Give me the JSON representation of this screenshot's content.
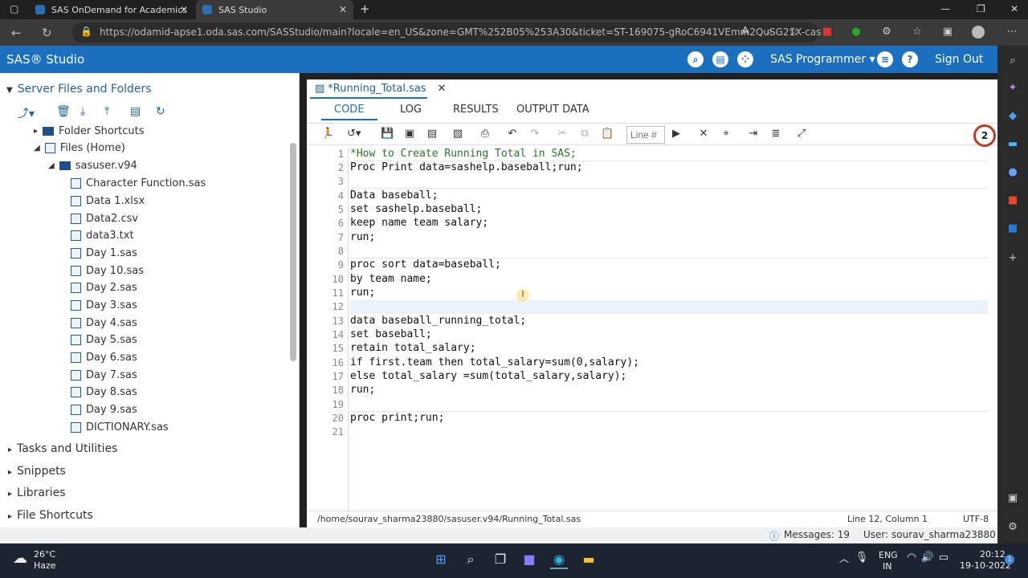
{
  "browser": {
    "tabs": [
      {
        "title": "SAS OnDemand for Academics"
      },
      {
        "title": "SAS Studio"
      }
    ],
    "url": "https://odamid-apse1.oda.sas.com/SASStudio/main?locale=en_US&zone=GMT%252B05%253A30&ticket=ST-169075-gRoC6941VEmm2QuSG21X-cas"
  },
  "app": {
    "brand": "SAS® Studio",
    "role": "SAS Programmer",
    "signout": "Sign Out"
  },
  "sidebar": {
    "header": "Server Files and Folders",
    "folder_shortcuts": "Folder Shortcuts",
    "files_home": "Files (Home)",
    "sasuser": "sasuser.v94",
    "files": [
      "Character Function.sas",
      "Data 1.xlsx",
      "Data2.csv",
      "data3.txt",
      "Day 1.sas",
      "Day 10.sas",
      "Day 2.sas",
      "Day 3.sas",
      "Day 4.sas",
      "Day 5.sas",
      "Day 6.sas",
      "Day 7.sas",
      "Day 8.sas",
      "Day 9.sas",
      "DICTIONARY.sas"
    ],
    "sections": [
      "Tasks and Utilities",
      "Snippets",
      "Libraries",
      "File Shortcuts"
    ]
  },
  "editor": {
    "file_tab": "*Running_Total.sas",
    "subtabs": [
      "CODE",
      "LOG",
      "RESULTS",
      "OUTPUT DATA"
    ],
    "line_placeholder": "Line #",
    "lines": [
      "*How to Create Running Total in SAS;",
      "Proc Print data=sashelp.baseball;run;",
      "",
      "Data baseball;",
      "set sashelp.baseball;",
      "keep name team salary;",
      "run;",
      "",
      "proc sort data=baseball;",
      "by team name;",
      "run;",
      "",
      "data baseball_running_total;",
      "set baseball;",
      "retain total_salary;",
      "if first.team then total_salary=sum(0,salary);",
      "else total_salary =sum(total_salary,salary);",
      "run;",
      "",
      "proc print;run;",
      ""
    ]
  },
  "status": {
    "path": "/home/sourav_sharma23880/sasuser.v94/Running_Total.sas",
    "position": "Line 12, Column 1",
    "encoding": "UTF-8",
    "messages": "Messages: 19",
    "user": "User: sourav_sharma23880"
  },
  "notification_badge": "2",
  "taskbar": {
    "temp": "26°C",
    "weather": "Haze",
    "lang1": "ENG",
    "lang2": "IN",
    "time": "20:12",
    "date": "19-10-2022"
  }
}
